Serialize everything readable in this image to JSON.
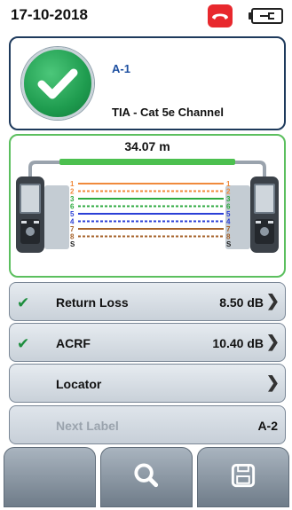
{
  "status_bar": {
    "date": "17-10-2018",
    "icons": [
      "phone-hangup-icon",
      "battery-plugged-icon"
    ],
    "phone_color": "#e8282d"
  },
  "result": {
    "status_icon": "pass-check-icon",
    "cable_id": "A-1",
    "limit": "TIA - Cat 5e Channel",
    "status_color": "#1f9c4f"
  },
  "wiremap": {
    "length": "34.07 m",
    "left_pins": [
      "1",
      "2",
      "3",
      "6",
      "5",
      "4",
      "7",
      "8",
      "S"
    ],
    "right_pins": [
      "1",
      "2",
      "3",
      "6",
      "5",
      "4",
      "7",
      "8",
      "S"
    ],
    "pair_colors": [
      "#f08a3c",
      "#f08a3c",
      "#2eaa3f",
      "#2eaa3f",
      "#2b3fd6",
      "#2b3fd6",
      "#a6622a",
      "#a6622a",
      "#222222"
    ]
  },
  "measurements": [
    {
      "label": "Return Loss",
      "value": "8.50 dB",
      "passed": true
    },
    {
      "label": "ACRF",
      "value": "10.40 dB",
      "passed": true
    },
    {
      "label": "Locator",
      "value": "",
      "passed": false
    }
  ],
  "next_label": {
    "label": "Next Label",
    "value": "A-2"
  },
  "toolbar": {
    "icons": [
      "blank-icon",
      "search-icon",
      "save-icon"
    ]
  },
  "glyphs": {
    "check": "✔",
    "chevron": "❯"
  }
}
